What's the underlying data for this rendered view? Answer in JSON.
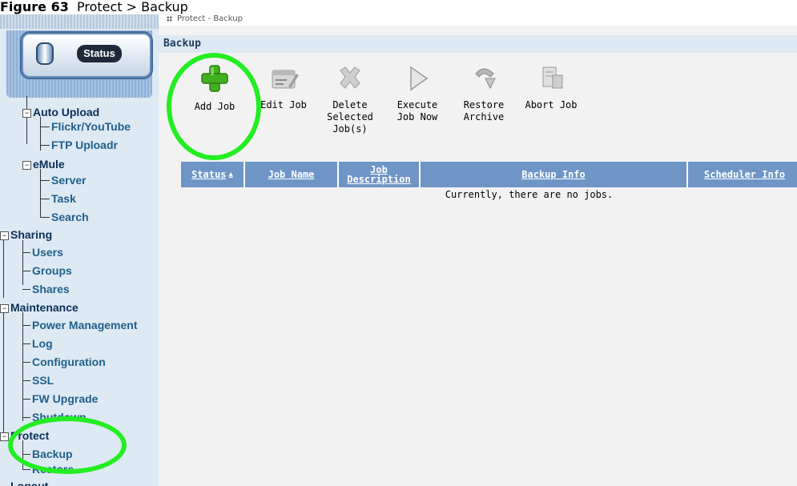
{
  "caption": {
    "label": "Figure 63",
    "text": "Protect > Backup"
  },
  "sidebar": {
    "status_label": "Status",
    "items": [
      {
        "label": "Auto Upload",
        "level": 1,
        "expander": "−"
      },
      {
        "label": "Flickr/YouTube",
        "level": 2
      },
      {
        "label": "FTP Uploadr",
        "level": 2
      },
      {
        "label": "eMule",
        "level": 1,
        "expander": "−"
      },
      {
        "label": "Server",
        "level": 2
      },
      {
        "label": "Task",
        "level": 2
      },
      {
        "label": "Search",
        "level": 2
      },
      {
        "label": "Sharing",
        "level": 0,
        "expander": "−"
      },
      {
        "label": "Users",
        "level": 1
      },
      {
        "label": "Groups",
        "level": 1
      },
      {
        "label": "Shares",
        "level": 1
      },
      {
        "label": "Maintenance",
        "level": 0,
        "expander": "−"
      },
      {
        "label": "Power Management",
        "level": 1
      },
      {
        "label": "Log",
        "level": 1
      },
      {
        "label": "Configuration",
        "level": 1
      },
      {
        "label": "SSL",
        "level": 1
      },
      {
        "label": "FW Upgrade",
        "level": 1
      },
      {
        "label": "Shutdown",
        "level": 1
      },
      {
        "label": "Protect",
        "level": 0,
        "expander": "−"
      },
      {
        "label": "Backup",
        "level": 1
      },
      {
        "label": "Restore",
        "level": 1
      },
      {
        "label": "Logout",
        "level": 0
      }
    ]
  },
  "breadcrumb": "Protect - Backup",
  "page_title": "Backup",
  "toolbar": {
    "add": "Add Job",
    "edit": "Edit Job",
    "delete": "Delete\nSelected\nJob(s)",
    "execute": "Execute\nJob Now",
    "restore": "Restore\nArchive",
    "abort": "Abort Job"
  },
  "table": {
    "columns": [
      "Status",
      "Job Name",
      "Job\nDescription",
      "Backup Info",
      "Scheduler Info"
    ],
    "empty_message": "Currently, there are no jobs."
  },
  "colors": {
    "highlight": "#22ee22",
    "header_blue": "#6e95c6",
    "sidebar_bg": "#dde9f3"
  }
}
